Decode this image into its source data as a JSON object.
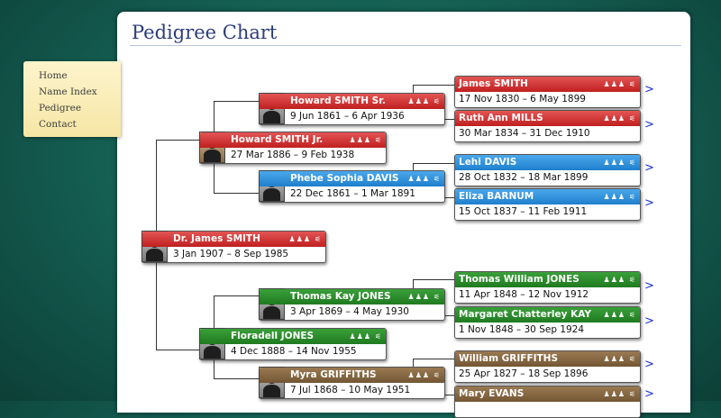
{
  "page": {
    "title": "Pedigree Chart"
  },
  "nav": {
    "items": [
      "Home",
      "Name Index",
      "Pedigree",
      "Contact"
    ]
  },
  "icons": {
    "person": "person-icon",
    "family": "family-icon",
    "tree": "tree-icon",
    "glyphs": "♟♟♟ ⚟"
  },
  "more_glyph": ">",
  "colors": {
    "background": "#145c50",
    "male_parent": "#c01f1f",
    "female_parent": "#1f7fcc",
    "green_line": "#1f7a1f",
    "brown_line": "#735634",
    "more_link": "#1a2fd8",
    "title": "#2c3d7a"
  },
  "people": {
    "root": {
      "name": "Dr. James SMITH",
      "dates": "3 Jan 1907 – 8 Sep 1985"
    },
    "father": {
      "name": "Howard SMITH Jr.",
      "dates": "27 Mar 1886 – 9 Feb 1938"
    },
    "mother": {
      "name": "Floradell JONES",
      "dates": "4 Dec 1888 – 14 Nov 1955"
    },
    "pat_grandfather": {
      "name": "Howard SMITH Sr.",
      "dates": "9 Jun 1861 – 6 Apr 1936"
    },
    "pat_grandmother": {
      "name": "Phebe Sophia DAVIS",
      "dates": "22 Dec 1861 – 1 Mar 1891"
    },
    "mat_grandfather": {
      "name": "Thomas Kay JONES",
      "dates": "3 Apr 1869 – 4 May 1930"
    },
    "mat_grandmother": {
      "name": "Myra GRIFFITHS",
      "dates": "7 Jul 1868 – 10 May 1951"
    },
    "gg1": {
      "name": "James SMITH",
      "dates": "17 Nov 1830 – 6 May 1899"
    },
    "gg2": {
      "name": "Ruth Ann MILLS",
      "dates": "30 Mar 1834 – 31 Dec 1910"
    },
    "gg3": {
      "name": "Lehi DAVIS",
      "dates": "28 Oct 1832 – 18 Mar 1899"
    },
    "gg4": {
      "name": "Eliza BARNUM",
      "dates": "15 Oct 1837 – 11 Feb 1911"
    },
    "gg5": {
      "name": "Thomas William JONES",
      "dates": "11 Apr 1848 – 12 Nov 1912"
    },
    "gg6": {
      "name": "Margaret Chatterley KAY",
      "dates": "1 Nov 1848 – 30 Sep 1924"
    },
    "gg7": {
      "name": "William GRIFFITHS",
      "dates": "25 Apr 1827 – 18 Sep 1896"
    },
    "gg8": {
      "name": "Mary EVANS",
      "dates": ""
    }
  }
}
